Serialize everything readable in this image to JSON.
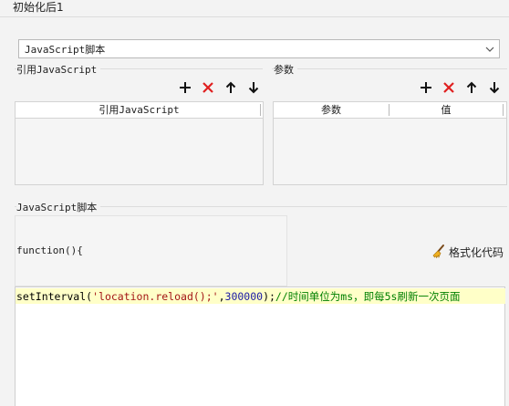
{
  "window": {
    "title": "初始化后1"
  },
  "script_type": {
    "value": "JavaScript脚本"
  },
  "imports_group": {
    "title": "引用JavaScript",
    "column_header": "引用JavaScript"
  },
  "params_group": {
    "title": "参数",
    "columns": [
      "参数",
      "值"
    ]
  },
  "toolbar_icons": [
    "add-icon",
    "delete-icon",
    "move-up-icon",
    "move-down-icon"
  ],
  "script_group": {
    "title": "JavaScript脚本",
    "preamble": "function(){",
    "format_button": "格式化代码",
    "code": {
      "fn": "setInterval(",
      "str": "'location.reload();'",
      "sep": ",",
      "num": "300000",
      "end": ");",
      "comment": "//时间单位为ms，即每5s刷新一次页面"
    },
    "current_line_color": "#ffffc8"
  },
  "colors": {
    "delete": "#e02020",
    "background": "#f3f3f3"
  }
}
